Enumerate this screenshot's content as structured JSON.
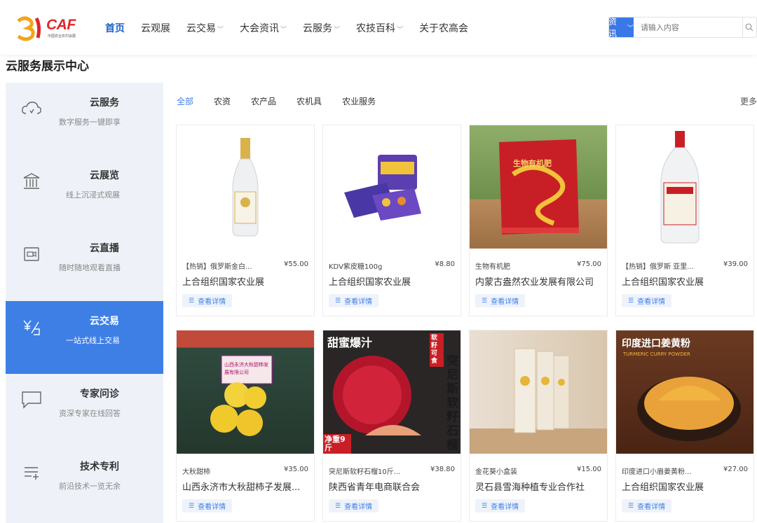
{
  "header": {
    "logo": {
      "brand": "CAF",
      "subtitle": "中国农业农村会展"
    },
    "nav": [
      {
        "label": "首页",
        "active": true,
        "dropdown": false
      },
      {
        "label": "云观展",
        "active": false,
        "dropdown": false
      },
      {
        "label": "云交易",
        "active": false,
        "dropdown": true
      },
      {
        "label": "大会资讯",
        "active": false,
        "dropdown": true
      },
      {
        "label": "云服务",
        "active": false,
        "dropdown": true
      },
      {
        "label": "农技百科",
        "active": false,
        "dropdown": true
      },
      {
        "label": "关于农高会",
        "active": false,
        "dropdown": false
      }
    ],
    "search": {
      "category": "资讯",
      "placeholder": "请输入内容"
    }
  },
  "page_title": "云服务展示中心",
  "sidebar": {
    "items": [
      {
        "title": "云服务",
        "desc": "数字服务一键即享",
        "icon": "cloud-icon",
        "active": false
      },
      {
        "title": "云展览",
        "desc": "线上沉浸式观展",
        "icon": "museum-icon",
        "active": false
      },
      {
        "title": "云直播",
        "desc": "随时随地观看直播",
        "icon": "live-camera-icon",
        "active": false
      },
      {
        "title": "云交易",
        "desc": "一站式线上交易",
        "icon": "trade-icon",
        "active": true
      },
      {
        "title": "专家问诊",
        "desc": "资深专家在线回答",
        "icon": "chat-bubble-icon",
        "active": false
      },
      {
        "title": "技术专利",
        "desc": "前沿技术一览无余",
        "icon": "list-add-icon",
        "active": false
      }
    ]
  },
  "tabs": [
    {
      "label": "全部",
      "active": true
    },
    {
      "label": "农资",
      "active": false
    },
    {
      "label": "农产品",
      "active": false
    },
    {
      "label": "农机具",
      "active": false
    },
    {
      "label": "农业服务",
      "active": false
    }
  ],
  "more_label": "更多",
  "detail_label": "查看详情",
  "products": [
    {
      "name": "【热销】俄罗斯金白...",
      "price": "¥55.00",
      "company": "上合组织国家农业展"
    },
    {
      "name": "KDV紫皮糖100g",
      "price": "¥8.80",
      "company": "上合组织国家农业展"
    },
    {
      "name": "生物有机肥",
      "price": "¥75.00",
      "company": "内蒙古盎然农业发展有限公司",
      "img_text": "生物有机肥"
    },
    {
      "name": "【热销】俄罗斯 亚里...",
      "price": "¥39.00",
      "company": "上合组织国家农业展"
    },
    {
      "name": "大秋甜柿",
      "price": "¥35.00",
      "company": "山西永济市大秋甜柿子发展...",
      "img_text": "山西永济大秋甜柿发展有限公司"
    },
    {
      "name": "突尼斯软籽石榴10斤...",
      "price": "¥38.80",
      "company": "陕西省青年电商联合会",
      "img_text_top": "甜蜜爆汁",
      "img_text_side": "突尼斯软籽石榴",
      "img_text_tag": "软籽可食",
      "img_text_weight": "净重9斤"
    },
    {
      "name": "金花葵小盒装",
      "price": "¥15.00",
      "company": "灵石县雪海种植专业合作社"
    },
    {
      "name": "印度进口小眉姜黄粉...",
      "price": "¥27.00",
      "company": "上合组织国家农业展",
      "img_text_top": "印度进口姜黄粉",
      "img_text_sub": "TURMERIC CURRY POWDER"
    }
  ]
}
